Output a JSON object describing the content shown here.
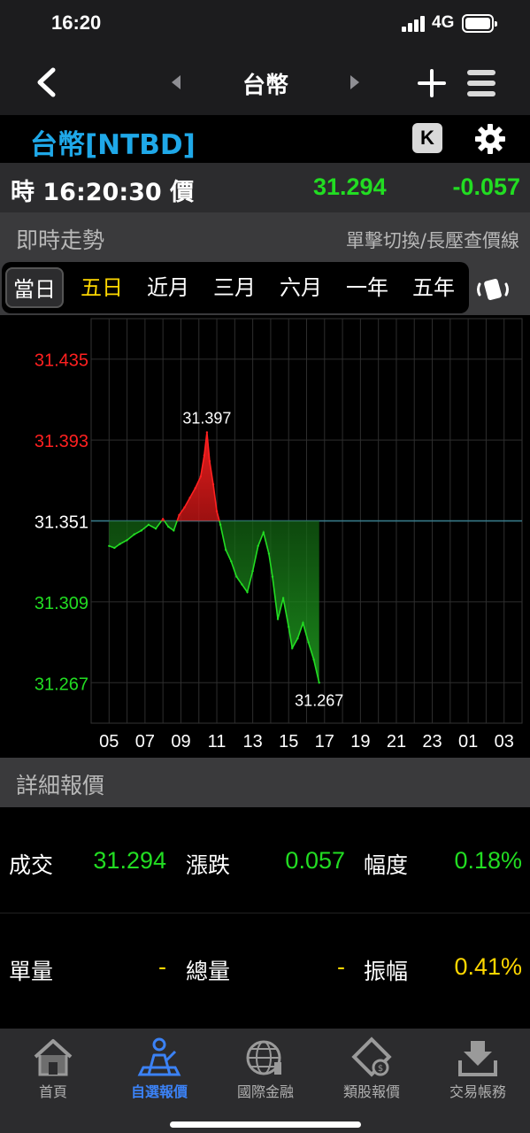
{
  "status": {
    "time": "16:20",
    "network": "4G"
  },
  "nav": {
    "title": "台幣"
  },
  "symbol": {
    "name": "台幣[NTBD]",
    "k_label": "K"
  },
  "quote": {
    "label": "時 16:20:30 價",
    "price": "31.294",
    "change": "-0.057"
  },
  "trend_section": {
    "title": "即時走勢",
    "hint": "單擊切換/長壓查價線"
  },
  "ranges": [
    "當日",
    "五日",
    "近月",
    "三月",
    "六月",
    "一年",
    "五年"
  ],
  "chart_data": {
    "type": "area",
    "reference_value": 31.351,
    "ylim": [
      31.246,
      31.456
    ],
    "y_ticks": [
      {
        "value": 31.435,
        "label": "31.435",
        "color": "#ff2020"
      },
      {
        "value": 31.393,
        "label": "31.393",
        "color": "#ff2020"
      },
      {
        "value": 31.351,
        "label": "31.351",
        "color": "#ffffff"
      },
      {
        "value": 31.309,
        "label": "31.309",
        "color": "#22dd22"
      },
      {
        "value": 31.267,
        "label": "31.267",
        "color": "#22dd22"
      }
    ],
    "x_ticks": [
      "05",
      "07",
      "09",
      "11",
      "13",
      "15",
      "17",
      "19",
      "21",
      "23",
      "01",
      "03"
    ],
    "annotations": [
      {
        "label": "31.397",
        "x": 10.45,
        "y": 31.397
      },
      {
        "label": "31.267",
        "x": 16.7,
        "y": 31.267
      }
    ],
    "series": [
      {
        "x": [
          5.0,
          5.3,
          5.6,
          6.0,
          6.4,
          6.8,
          7.2,
          7.6,
          8.0,
          8.3,
          8.6,
          8.9,
          9.2,
          9.5,
          9.8,
          10.1,
          10.3,
          10.45,
          10.6,
          10.8,
          11.0,
          11.2,
          11.5,
          11.8,
          12.1,
          12.4,
          12.7,
          13.0,
          13.3,
          13.6,
          13.9,
          14.1,
          14.4,
          14.7,
          15.0,
          15.2,
          15.5,
          15.8,
          16.1,
          16.4,
          16.7
        ],
        "y": [
          31.338,
          31.337,
          31.339,
          31.341,
          31.344,
          31.346,
          31.349,
          31.347,
          31.352,
          31.348,
          31.346,
          31.354,
          31.358,
          31.363,
          31.368,
          31.374,
          31.385,
          31.397,
          31.382,
          31.37,
          31.356,
          31.349,
          31.336,
          31.33,
          31.322,
          31.318,
          31.314,
          31.325,
          31.338,
          31.345,
          31.334,
          31.322,
          31.3,
          31.311,
          31.296,
          31.285,
          31.29,
          31.298,
          31.288,
          31.279,
          31.267
        ]
      }
    ]
  },
  "detail_section": {
    "title": "詳細報價"
  },
  "details": {
    "row1": {
      "l1": "成交",
      "v1": "31.294",
      "l2": "漲跌",
      "v2": "0.057",
      "l3": "幅度",
      "v3": "0.18%"
    },
    "row2": {
      "l1": "單量",
      "v1": "-",
      "l2": "總量",
      "v2": "-",
      "l3": "振幅",
      "v3": "0.41%"
    }
  },
  "colors": {
    "up": "#ff2020",
    "down": "#22dd22",
    "accent": "#1fa8e8",
    "highlight": "#ffd700",
    "active_tab": "#3b82f6"
  },
  "tabs": [
    {
      "label": "首頁",
      "icon": "home-icon"
    },
    {
      "label": "自選報價",
      "icon": "watchlist-icon"
    },
    {
      "label": "國際金融",
      "icon": "globe-icon"
    },
    {
      "label": "類股報價",
      "icon": "sector-icon"
    },
    {
      "label": "交易帳務",
      "icon": "trade-icon"
    }
  ]
}
